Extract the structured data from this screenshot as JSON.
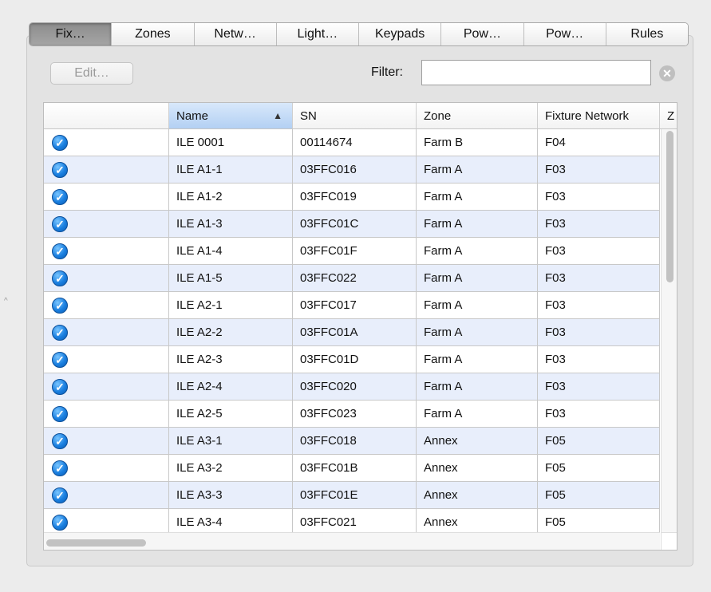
{
  "tabs": [
    {
      "label": "Fix…",
      "selected": true
    },
    {
      "label": "Zones",
      "selected": false
    },
    {
      "label": "Netw…",
      "selected": false
    },
    {
      "label": "Light…",
      "selected": false
    },
    {
      "label": "Keypads",
      "selected": false
    },
    {
      "label": "Pow…",
      "selected": false
    },
    {
      "label": "Pow…",
      "selected": false
    },
    {
      "label": "Rules",
      "selected": false
    }
  ],
  "toolbar": {
    "edit_label": "Edit…",
    "filter_label": "Filter:",
    "filter_value": "",
    "clear_icon": "clear-circle-icon"
  },
  "table": {
    "columns": [
      "",
      "Name",
      "SN",
      "Zone",
      "Fixture Network",
      "Z"
    ],
    "sorted_column": "Name",
    "sort_direction": "ascending",
    "status_icon": "checkmark-circle-icon",
    "rows": [
      {
        "name": "ILE 0001",
        "sn": "00114674",
        "zone": "Farm B",
        "network": "F04"
      },
      {
        "name": "ILE A1-1",
        "sn": "03FFC016",
        "zone": "Farm A",
        "network": "F03"
      },
      {
        "name": "ILE A1-2",
        "sn": "03FFC019",
        "zone": "Farm A",
        "network": "F03"
      },
      {
        "name": "ILE A1-3",
        "sn": "03FFC01C",
        "zone": "Farm A",
        "network": "F03"
      },
      {
        "name": "ILE A1-4",
        "sn": "03FFC01F",
        "zone": "Farm A",
        "network": "F03"
      },
      {
        "name": "ILE A1-5",
        "sn": "03FFC022",
        "zone": "Farm A",
        "network": "F03"
      },
      {
        "name": "ILE A2-1",
        "sn": "03FFC017",
        "zone": "Farm A",
        "network": "F03"
      },
      {
        "name": "ILE A2-2",
        "sn": "03FFC01A",
        "zone": "Farm A",
        "network": "F03"
      },
      {
        "name": "ILE A2-3",
        "sn": "03FFC01D",
        "zone": "Farm A",
        "network": "F03"
      },
      {
        "name": "ILE A2-4",
        "sn": "03FFC020",
        "zone": "Farm A",
        "network": "F03"
      },
      {
        "name": "ILE A2-5",
        "sn": "03FFC023",
        "zone": "Farm A",
        "network": "F03"
      },
      {
        "name": "ILE A3-1",
        "sn": "03FFC018",
        "zone": "Annex",
        "network": "F05"
      },
      {
        "name": "ILE A3-2",
        "sn": "03FFC01B",
        "zone": "Annex",
        "network": "F05"
      },
      {
        "name": "ILE A3-3",
        "sn": "03FFC01E",
        "zone": "Annex",
        "network": "F05"
      },
      {
        "name": "ILE A3-4",
        "sn": "03FFC021",
        "zone": "Annex",
        "network": "F05"
      }
    ]
  },
  "colors": {
    "selected_tab": "#9a9a9a",
    "sorted_header": "#b3d0f3",
    "alt_row": "#e8eefb",
    "check_blue": "#1a7fe0"
  }
}
